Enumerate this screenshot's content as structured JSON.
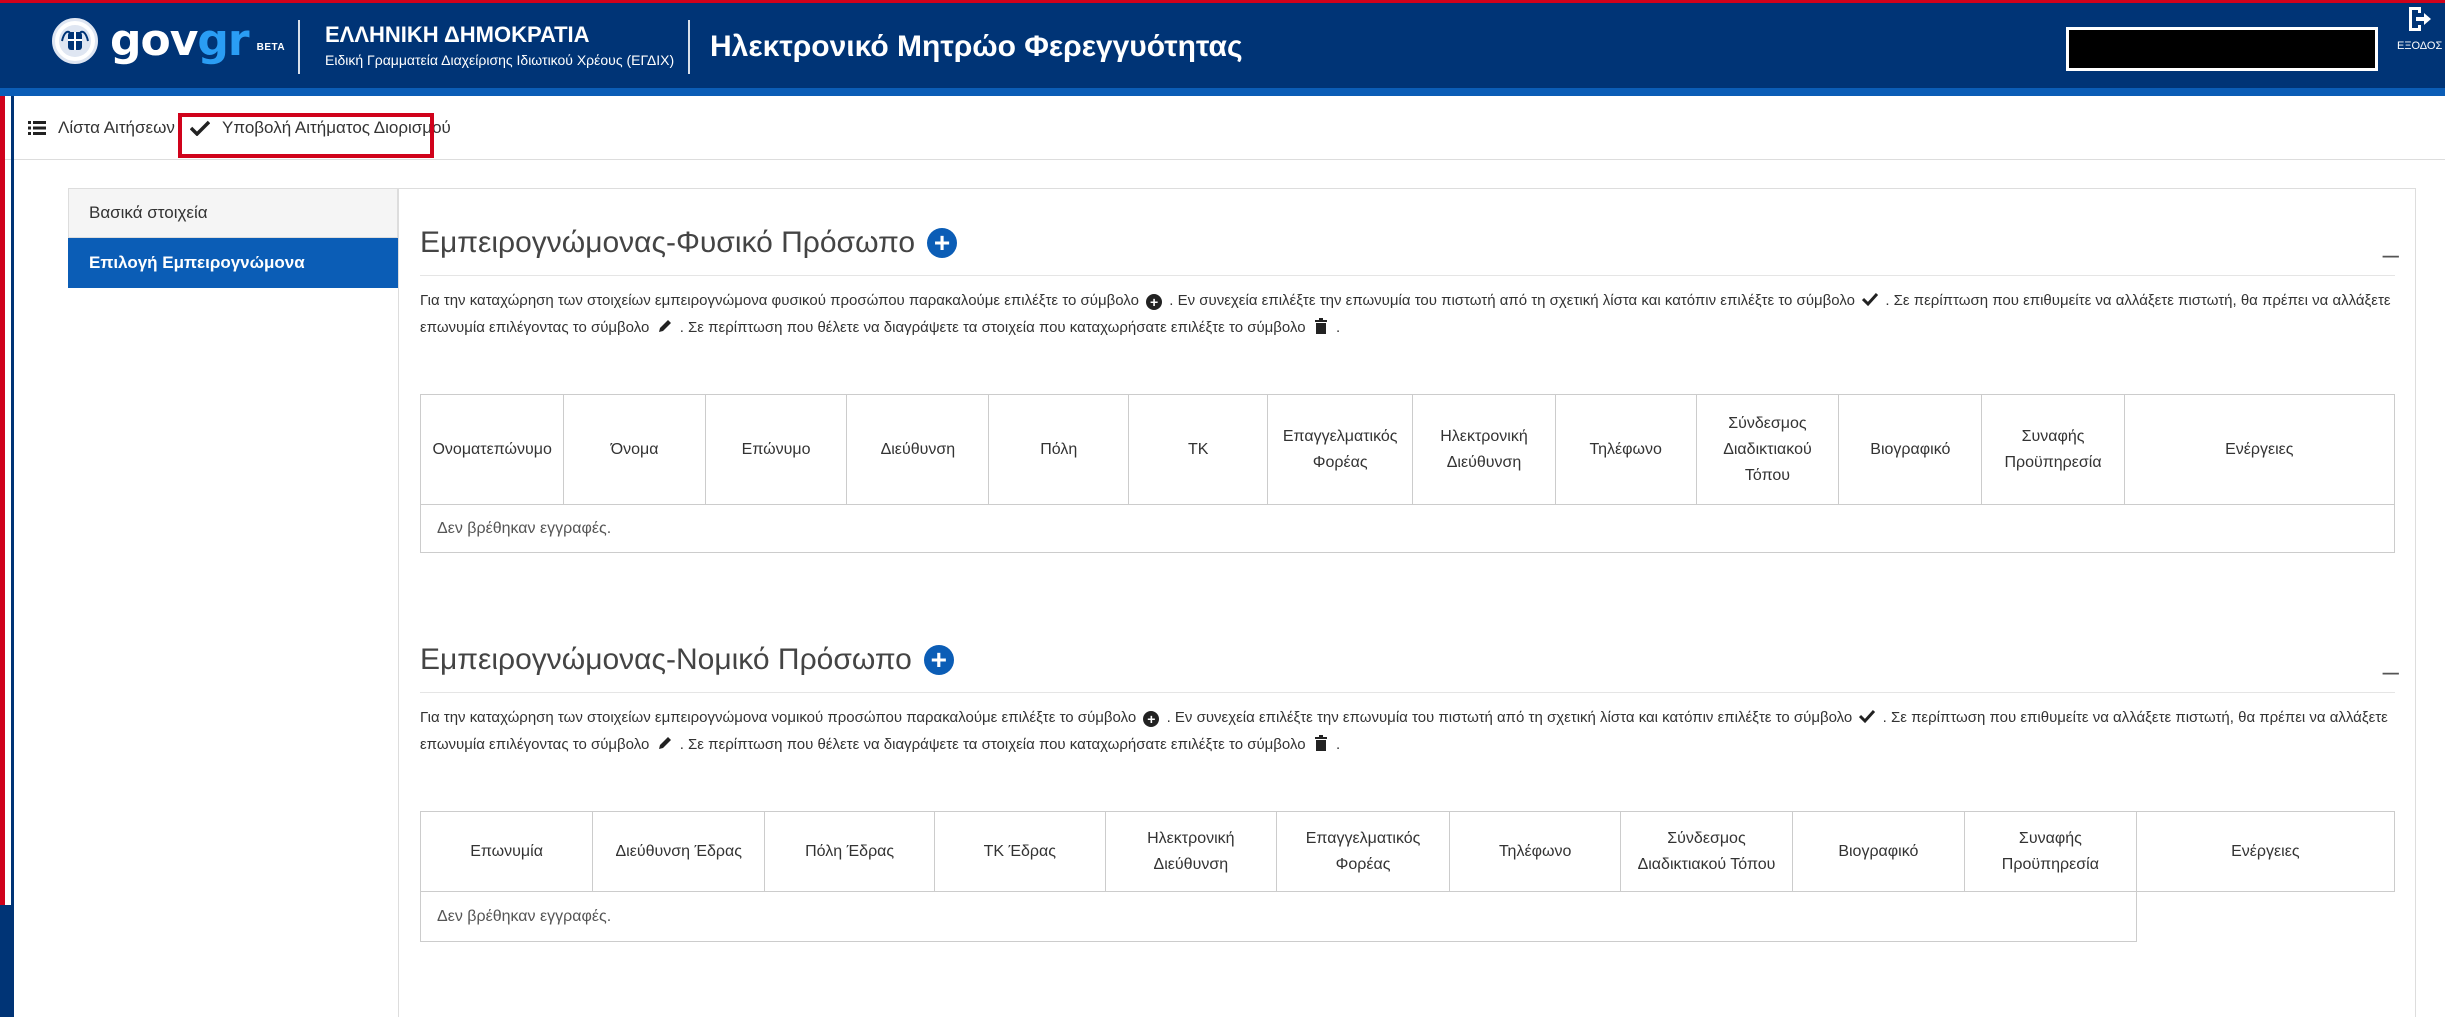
{
  "header": {
    "brand": "gov",
    "brand_accent": "gr",
    "beta": "BETA",
    "ministry_title": "ΕΛΛΗΝΙΚΗ ΔΗΜΟΚΡΑΤΙΑ",
    "ministry_subtitle": "Ειδική Γραμματεία Διαχείρισης Ιδιωτικού Χρέους (ΕΓΔΙΧ)",
    "app_title": "Ηλεκτρονικό Μητρώο Φερεγγυότητας",
    "exit_label": "ΕΞΟΔΟΣ",
    "colors": {
      "header_bg": "#003476",
      "accent": "#0b5db6",
      "highlight": "#d0021b"
    }
  },
  "nav": {
    "list_label": "Λίστα Αιτήσεων",
    "list_icon": "list-icon",
    "submit_label": "Υποβολή Αιτήματος Διορισμού",
    "submit_icon": "check-icon"
  },
  "sidebar": {
    "items": [
      {
        "label": "Βασικά στοιχεία",
        "active": false
      },
      {
        "label": "Επιλογή Εμπειρογνώμονα",
        "active": true
      }
    ]
  },
  "natural": {
    "title": "Εμπειρογνώμονας-Φυσικό Πρόσωπο",
    "instr_1": "Για την καταχώρηση των στοιχείων εμπειρογνώμονα φυσικού προσώπου παρακαλούμε επιλέξτε το σύμβολο",
    "instr_2": ". Εν συνεχεία επιλέξτε την επωνυμία του πιστωτή από τη σχετική λίστα και κατόπιν επιλέξτε το σύμβολο",
    "instr_3": ". Σε περίπτωση που επιθυμείτε να αλλάξετε πιστωτή, θα πρέπει να αλλάξετε επωνυμία επιλέγοντας το σύμβολο",
    "instr_4": ". Σε περίπτωση που θέλετε να διαγράψετε τα στοιχεία που καταχωρήσατε επιλέξτε το σύμβολο",
    "instr_end": ".",
    "columns": [
      "Ονοματεπώνυμο",
      "Όνομα",
      "Επώνυμο",
      "Διεύθυνση",
      "Πόλη",
      "ΤΚ",
      "Επαγγελματικός Φορέας",
      "Ηλεκτρονική Διεύθυνση",
      "Τηλέφωνο",
      "Σύνδεσμος Διαδικτιακού Τόπου",
      "Βιογραφικό",
      "Συναφής Προϋπηρεσία",
      "Ενέργειες"
    ],
    "empty": "Δεν βρέθηκαν εγγραφές."
  },
  "legal": {
    "title": "Εμπειρογνώμονας-Νομικό Πρόσωπο",
    "instr_1": "Για την καταχώρηση των στοιχείων εμπειρογνώμονα νομικού προσώπου παρακαλούμε επιλέξτε το σύμβολο",
    "instr_2": ". Εν συνεχεία επιλέξτε την επωνυμία του πιστωτή από τη σχετική λίστα και κατόπιν επιλέξτε το σύμβολο",
    "instr_3": ". Σε περίπτωση που επιθυμείτε να αλλάξετε πιστωτή, θα πρέπει να αλλάξετε επωνυμία επιλέγοντας το σύμβολο",
    "instr_4": ". Σε περίπτωση που θέλετε να διαγράψετε τα στοιχεία που καταχωρήσατε επιλέξτε το σύμβολο",
    "instr_end": ".",
    "columns": [
      "Επωνυμία",
      "Διεύθυνση Έδρας",
      "Πόλη Έδρας",
      "ΤΚ Έδρας",
      "Ηλεκτρονική Διεύθυνση",
      "Επαγγελματικός Φορέας",
      "Τηλέφωνο",
      "Σύνδεσμος Διαδικτιακού Τόπου",
      "Βιογραφικό",
      "Συναφής Προϋπηρεσία",
      "Ενέργειες"
    ],
    "empty": "Δεν βρέθηκαν εγγραφές."
  }
}
